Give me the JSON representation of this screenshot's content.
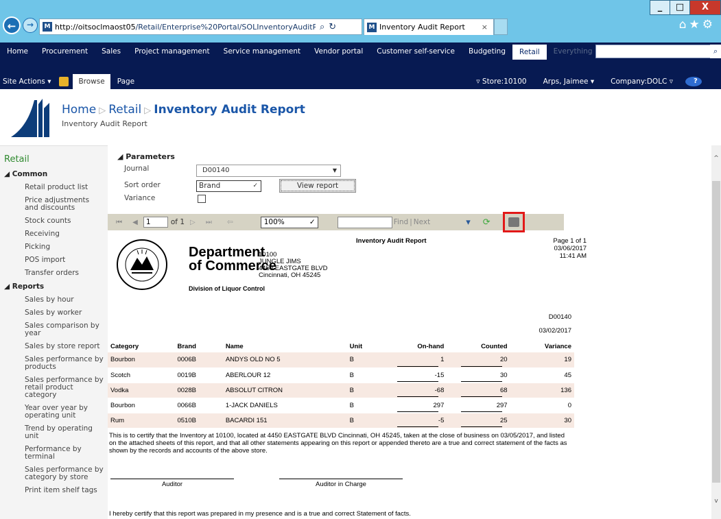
{
  "browser": {
    "url_host": "http://oitsoclmaost05",
    "url_path": "/Retail/Enterprise%20Portal/SOLInventoryAuditRepor",
    "tab_title": "Inventory Audit Report",
    "tab_close": "×",
    "win_min": "_",
    "win_max": "□",
    "win_close": "X",
    "search_icon": "⌕",
    "refresh_icon": "↻"
  },
  "topnav": {
    "items": [
      "Home",
      "Procurement",
      "Sales",
      "Project management",
      "Service management",
      "Vendor portal",
      "Customer self-service",
      "Budgeting",
      "Retail"
    ],
    "everything": "Everything",
    "search_icon": "⌕"
  },
  "ribbon": {
    "site_actions": "Site Actions ▾",
    "browse": "Browse",
    "page": "Page",
    "store": "▿ Store:10100",
    "user": "Arps, Jaimee ▾",
    "company": "Company:DOLC ▿",
    "help": "?"
  },
  "header": {
    "crumb_home": "Home",
    "crumb_retail": "Retail",
    "crumb_current": "Inventory Audit Report",
    "subtitle": "Inventory Audit Report",
    "sep": "▷"
  },
  "leftnav": {
    "retail": "Retail",
    "common_header": "◢ Common",
    "common_items": [
      "Retail product list",
      "Price adjustments and discounts",
      "Stock counts",
      "Receiving",
      "Picking",
      "POS import",
      "Transfer orders"
    ],
    "reports_header": "◢ Reports",
    "report_items": [
      "Sales by hour",
      "Sales by worker",
      "Sales comparison by year",
      "Sales by store report",
      "Sales performance by products",
      "Sales performance by retail product category",
      "Year over year by operating unit",
      "Trend by operating unit",
      "Performance by terminal",
      "Sales performance by category by store",
      "Print item shelf tags"
    ]
  },
  "params": {
    "header": "◢ Parameters",
    "journal_label": "Journal",
    "journal_value": "D00140",
    "sort_label": "Sort order",
    "sort_value": "Brand",
    "variance_label": "Variance",
    "view_report": "View report"
  },
  "toolbar": {
    "first_prev": "⏮ ◀",
    "page": "1",
    "of": "of 1",
    "next_last": "▷ ⏭",
    "back": "⇦",
    "zoom": "100%",
    "find": "Find",
    "next": "Next",
    "find_sep": "|",
    "export_icon": "▾"
  },
  "report": {
    "dept_line1": "Department",
    "dept_line2": "of Commerce",
    "division": "Division of Liquor Control",
    "store_id": "10100",
    "store_name": "JUNGLE JIMS",
    "store_address": "4450 EASTGATE BLVD",
    "store_city": "Cincinnati, OH 45245",
    "title": "Inventory Audit Report",
    "page_info": "Page 1 of 1",
    "print_date": "03/06/2017",
    "print_time": "11:41 AM",
    "journal_id": "D00140",
    "report_date": "03/02/2017",
    "seal_top": "STATE OF OHIO",
    "seal_bottom": "DEPARTMENT OF COMMERCE",
    "columns": [
      "Category",
      "Brand",
      "Name",
      "Unit",
      "On-hand",
      "Counted",
      "Variance"
    ],
    "rows": [
      [
        "Bourbon",
        "0006B",
        "ANDYS OLD NO 5",
        "B",
        "1",
        "20",
        "19"
      ],
      [
        "Scotch",
        "0019B",
        "ABERLOUR 12",
        "B",
        "-15",
        "30",
        "45"
      ],
      [
        "Vodka",
        "0028B",
        "ABSOLUT CITRON",
        "B",
        "-68",
        "68",
        "136"
      ],
      [
        "Bourbon",
        "0066B",
        "1-JACK DANIELS",
        "B",
        "297",
        "297",
        "0"
      ],
      [
        "Rum",
        "0510B",
        "BACARDI 151",
        "B",
        "-5",
        "25",
        "30"
      ]
    ],
    "certify_text": "This is to certify that the Inventory at 10100, located at 4450 EASTGATE BLVD Cincinnati, OH 45245, taken at the close of business on 03/05/2017, and listed on the attached sheets of this report, and that all other statements appearing on this report or appended thereto are a true and correct statement of the facts as shown by the records and accounts of the above store.",
    "auditor": "Auditor",
    "auditor_in_charge": "Auditor in Charge",
    "certify2": "I hereby certify that this report was prepared in my presence and is a true and correct Statement of facts."
  },
  "colors": {
    "titlebar": "#6fc5e8",
    "nav": "#071a52",
    "row_alt": "#f7e9e2",
    "highlight": "#e21818"
  }
}
